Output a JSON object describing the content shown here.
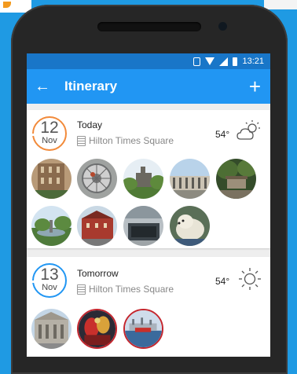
{
  "status_bar": {
    "time": "13:21"
  },
  "app_bar": {
    "title": "Itinerary",
    "back_icon": "back-arrow-icon",
    "add_icon": "plus-icon"
  },
  "days": [
    {
      "day_number": "12",
      "month": "Nov",
      "label": "Today",
      "hotel": "Hilton Times Square",
      "temperature": "54°",
      "weather_icon": "partly-cloudy-icon",
      "ring_color": "#f28a3a",
      "photo_count": 9
    },
    {
      "day_number": "13",
      "month": "Nov",
      "label": "Tomorrow",
      "hotel": "Hilton Times Square",
      "temperature": "54°",
      "weather_icon": "sunny-icon",
      "ring_color": "#2196f3",
      "photo_count": 3
    }
  ]
}
